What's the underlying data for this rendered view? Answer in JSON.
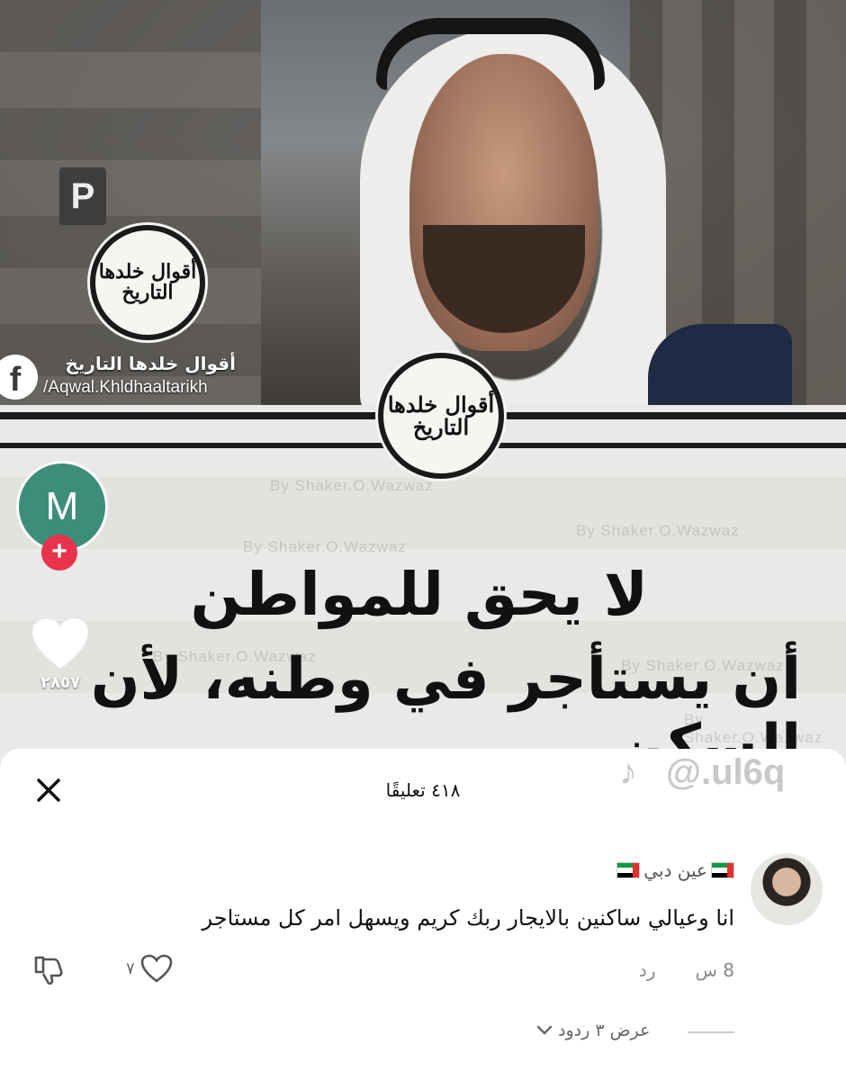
{
  "video": {
    "logo_text": "أقوال خلدها التاريخ",
    "fb_page_name": "أقوال خلدها التاريخ",
    "fb_handle": "/Aqwal.Khldhaaltarikh",
    "watermark_text": "By  Shaker.O.Wazwaz",
    "parking_sign": "P",
    "quote_line_1": "لا يحق للمواطن",
    "quote_line_2": "أن يستأجر في وطنه، لأن السكن"
  },
  "actions": {
    "creator_avatar_letter": "M",
    "follow_symbol": "+",
    "like_count": "٢٨٥٧"
  },
  "tiktok": {
    "note_symbol": "♪",
    "handle": "@.ul6q"
  },
  "comments_sheet": {
    "title": "٤١٨ تعليقًا",
    "close_icon": "x-icon",
    "comment": {
      "username": "عين دبي",
      "text": "انا وعيالي ساكنين بالايجار ربك كريم ويسهل امر كل مستاجر",
      "time": "8 س",
      "reply_label": "رد",
      "like_count": "٧"
    },
    "view_replies": "عرض ٣ ردود"
  },
  "colors": {
    "follow": "#e9334d",
    "avatar": "#3d8e78",
    "uae_red": "#e0312f",
    "uae_green": "#129843"
  }
}
